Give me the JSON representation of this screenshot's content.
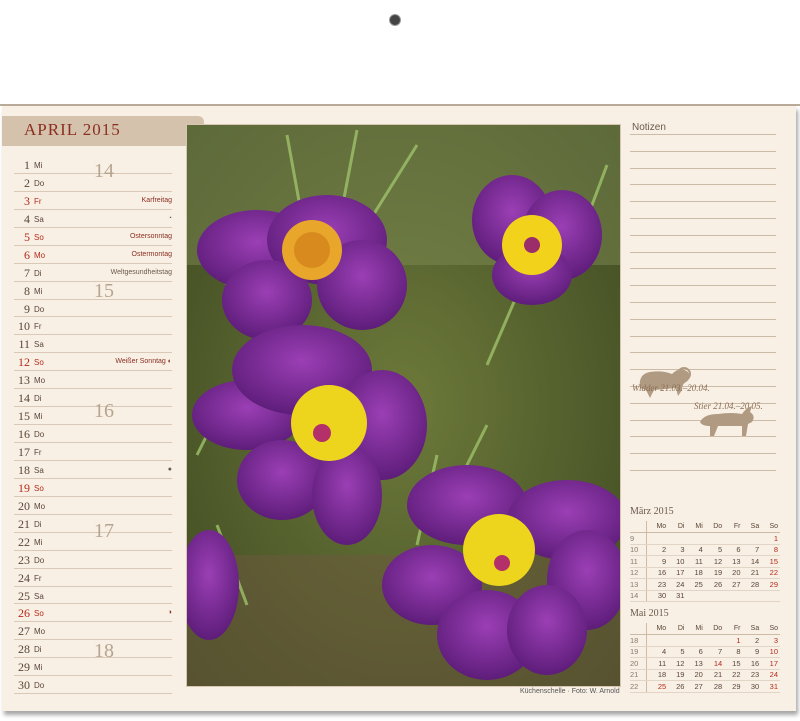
{
  "month_title": "APRIL 2015",
  "days": [
    {
      "num": "1",
      "wd": "Mi",
      "ev": "",
      "red": false
    },
    {
      "num": "2",
      "wd": "Do",
      "ev": "",
      "red": false
    },
    {
      "num": "3",
      "wd": "Fr",
      "ev": "Karfreitag",
      "red": true
    },
    {
      "num": "4",
      "wd": "Sa",
      "ev": "◔",
      "red": false
    },
    {
      "num": "5",
      "wd": "So",
      "ev": "Ostersonntag",
      "red": true
    },
    {
      "num": "6",
      "wd": "Mo",
      "ev": "Ostermontag",
      "red": true
    },
    {
      "num": "7",
      "wd": "Di",
      "ev": "Weltgesundheitstag",
      "red": false
    },
    {
      "num": "8",
      "wd": "Mi",
      "ev": "",
      "red": false
    },
    {
      "num": "9",
      "wd": "Do",
      "ev": "",
      "red": false
    },
    {
      "num": "10",
      "wd": "Fr",
      "ev": "",
      "red": false
    },
    {
      "num": "11",
      "wd": "Sa",
      "ev": "",
      "red": false
    },
    {
      "num": "12",
      "wd": "So",
      "ev": "Weißer Sonntag ◐",
      "red": true
    },
    {
      "num": "13",
      "wd": "Mo",
      "ev": "",
      "red": false
    },
    {
      "num": "14",
      "wd": "Di",
      "ev": "",
      "red": false
    },
    {
      "num": "15",
      "wd": "Mi",
      "ev": "",
      "red": false
    },
    {
      "num": "16",
      "wd": "Do",
      "ev": "",
      "red": false
    },
    {
      "num": "17",
      "wd": "Fr",
      "ev": "",
      "red": false
    },
    {
      "num": "18",
      "wd": "Sa",
      "ev": "●",
      "red": false
    },
    {
      "num": "19",
      "wd": "So",
      "ev": "",
      "red": true
    },
    {
      "num": "20",
      "wd": "Mo",
      "ev": "",
      "red": false
    },
    {
      "num": "21",
      "wd": "Di",
      "ev": "",
      "red": false
    },
    {
      "num": "22",
      "wd": "Mi",
      "ev": "",
      "red": false
    },
    {
      "num": "23",
      "wd": "Do",
      "ev": "",
      "red": false
    },
    {
      "num": "24",
      "wd": "Fr",
      "ev": "",
      "red": false
    },
    {
      "num": "25",
      "wd": "Sa",
      "ev": "",
      "red": false
    },
    {
      "num": "26",
      "wd": "So",
      "ev": "◑",
      "red": true
    },
    {
      "num": "27",
      "wd": "Mo",
      "ev": "",
      "red": false
    },
    {
      "num": "28",
      "wd": "Di",
      "ev": "",
      "red": false
    },
    {
      "num": "29",
      "wd": "Mi",
      "ev": "",
      "red": false
    },
    {
      "num": "30",
      "wd": "Do",
      "ev": "",
      "red": false
    }
  ],
  "week_numbers": [
    "14",
    "15",
    "16",
    "17",
    "18"
  ],
  "photo_caption": "Küchenschelle · Foto: W. Arnold",
  "notes_title": "Notizen",
  "zodiac": {
    "aries": "Widder 21.03.–20.04.",
    "taurus": "Stier 21.04.–20.05."
  },
  "march": {
    "title": "März 2015",
    "headers": [
      "Mo",
      "Di",
      "Mi",
      "Do",
      "Fr",
      "Sa",
      "So"
    ],
    "rows": [
      {
        "kw": "9",
        "d": [
          "",
          "",
          "",
          "",
          "",
          "",
          "1"
        ]
      },
      {
        "kw": "10",
        "d": [
          "2",
          "3",
          "4",
          "5",
          "6",
          "7",
          "8"
        ]
      },
      {
        "kw": "11",
        "d": [
          "9",
          "10",
          "11",
          "12",
          "13",
          "14",
          "15"
        ]
      },
      {
        "kw": "12",
        "d": [
          "16",
          "17",
          "18",
          "19",
          "20",
          "21",
          "22"
        ]
      },
      {
        "kw": "13",
        "d": [
          "23",
          "24",
          "25",
          "26",
          "27",
          "28",
          "29"
        ]
      },
      {
        "kw": "14",
        "d": [
          "30",
          "31",
          "",
          "",
          "",
          "",
          ""
        ]
      }
    ]
  },
  "may": {
    "title": "Mai 2015",
    "headers": [
      "Mo",
      "Di",
      "Mi",
      "Do",
      "Fr",
      "Sa",
      "So"
    ],
    "rows": [
      {
        "kw": "18",
        "d": [
          "",
          "",
          "",
          "",
          "1",
          "2",
          "3"
        ]
      },
      {
        "kw": "19",
        "d": [
          "4",
          "5",
          "6",
          "7",
          "8",
          "9",
          "10"
        ]
      },
      {
        "kw": "20",
        "d": [
          "11",
          "12",
          "13",
          "14",
          "15",
          "16",
          "17"
        ]
      },
      {
        "kw": "21",
        "d": [
          "18",
          "19",
          "20",
          "21",
          "22",
          "23",
          "24"
        ]
      },
      {
        "kw": "22",
        "d": [
          "25",
          "26",
          "27",
          "28",
          "29",
          "30",
          "31"
        ]
      }
    ],
    "red_days": [
      "1",
      "14",
      "25"
    ]
  },
  "colors": {
    "accent_red": "#b52a1a",
    "tab": "#d5c2ac",
    "paper": "#f8f0e5"
  }
}
